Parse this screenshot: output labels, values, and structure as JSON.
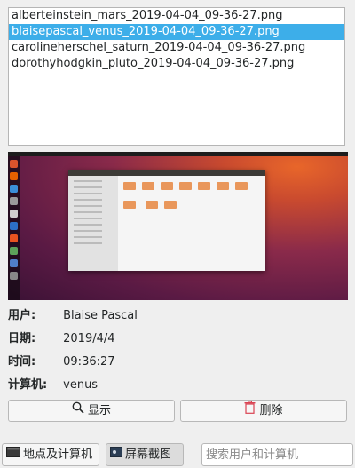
{
  "files": [
    {
      "name": "alberteinstein_mars_2019-04-04_09-36-27.png",
      "selected": false
    },
    {
      "name": "blaisepascal_venus_2019-04-04_09-36-27.png",
      "selected": true
    },
    {
      "name": "carolineherschel_saturn_2019-04-04_09-36-27.png",
      "selected": false
    },
    {
      "name": "dorothyhodgkin_pluto_2019-04-04_09-36-27.png",
      "selected": false
    }
  ],
  "details": {
    "user_label": "用户:",
    "user_value": "Blaise Pascal",
    "date_label": "日期:",
    "date_value": "2019/4/4",
    "time_label": "时间:",
    "time_value": "09:36:27",
    "computer_label": "计算机:",
    "computer_value": "venus"
  },
  "actions": {
    "show_label": "显示",
    "delete_label": "删除"
  },
  "bottom": {
    "location_tab": "地点及计算机",
    "screenshot_tab": "屏幕截图",
    "search_placeholder": "搜索用户和计算机"
  },
  "colors": {
    "selection": "#3daee9",
    "delete_icon": "#da4453"
  }
}
